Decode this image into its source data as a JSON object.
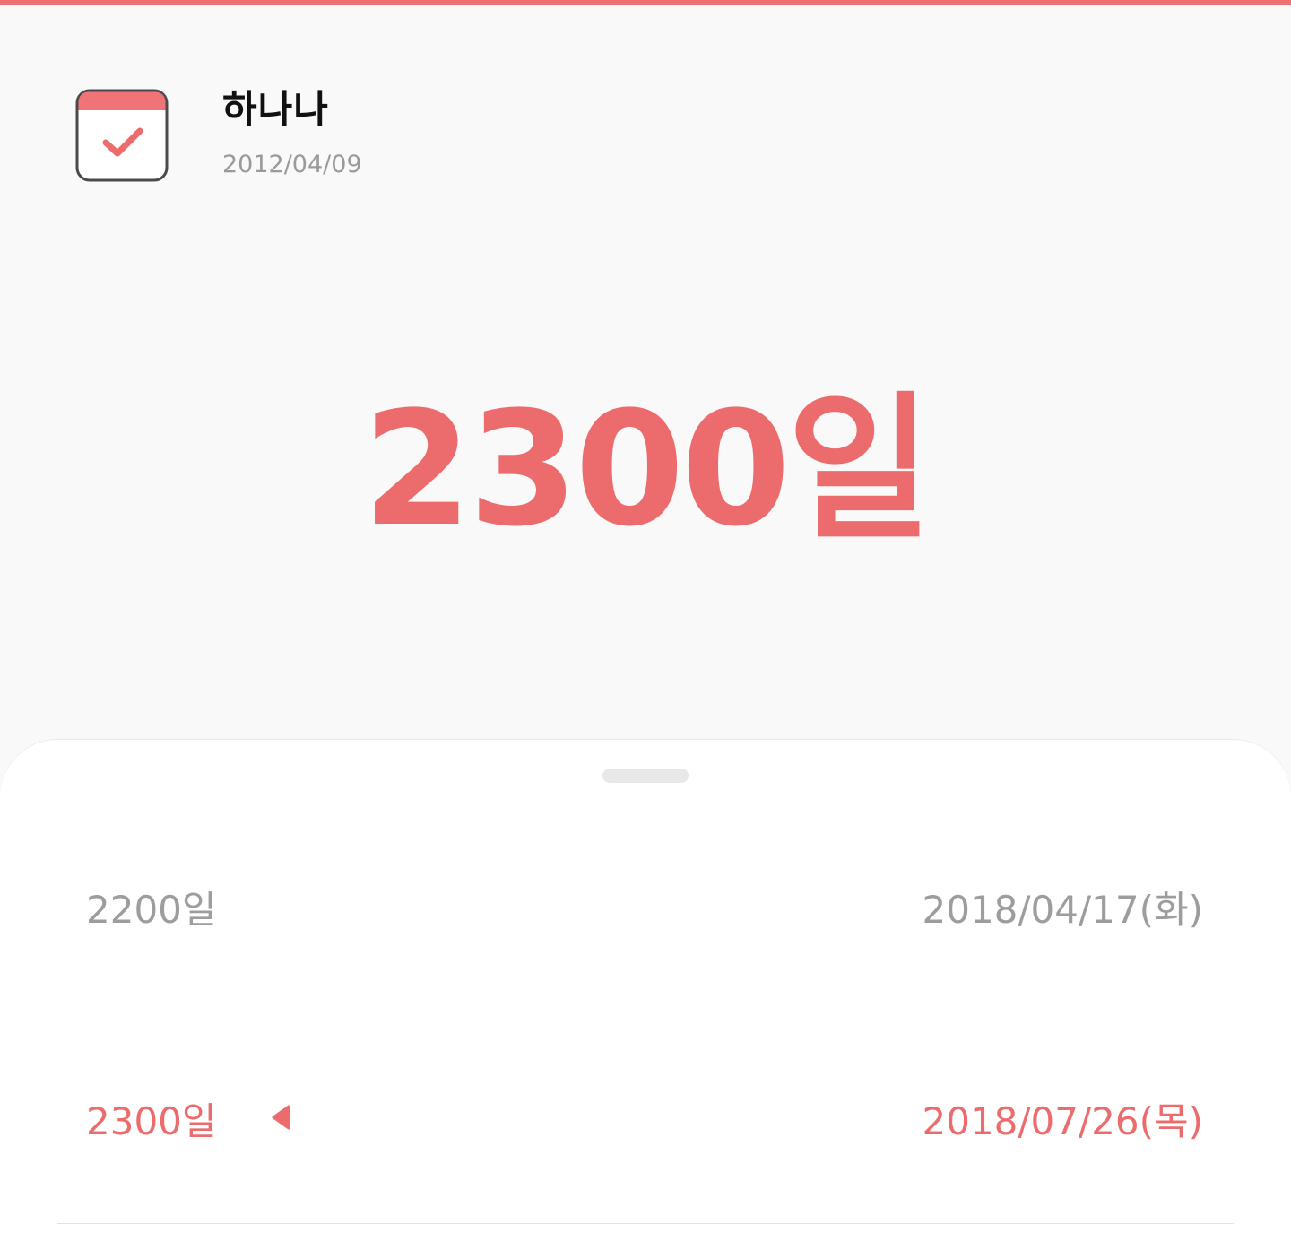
{
  "accent_color": "#ec6c6e",
  "header": {
    "icon": "calendar-check-icon",
    "title": "하나나",
    "date": "2012/04/09"
  },
  "main": {
    "count": "2300일"
  },
  "list": {
    "rows": [
      {
        "days": "2200일",
        "date": "2018/04/17(화)",
        "current": false
      },
      {
        "days": "2300일",
        "date": "2018/07/26(목)",
        "current": true,
        "marker_icon": "triangle-left-icon"
      }
    ]
  }
}
